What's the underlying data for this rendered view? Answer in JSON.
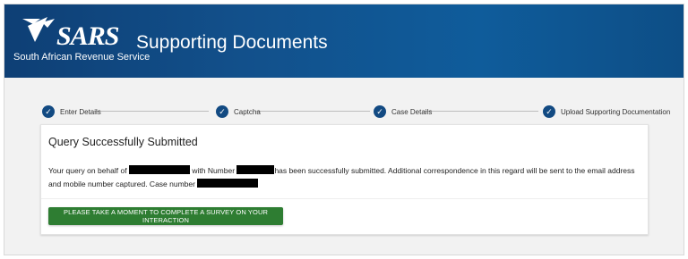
{
  "header": {
    "logo_text": "SARS",
    "org_name": "South African Revenue Service",
    "page_title": "Supporting Documents"
  },
  "stepper": {
    "steps": [
      {
        "label": "Enter Details",
        "status": "complete"
      },
      {
        "label": "Captcha",
        "status": "complete"
      },
      {
        "label": "Case Details",
        "status": "complete"
      },
      {
        "label": "Upload Supporting Documentation",
        "status": "complete"
      }
    ],
    "check_glyph": "✓"
  },
  "result": {
    "title": "Query Successfully Submitted",
    "text_1": "Your query on behalf of",
    "text_2": "with Number",
    "text_3": "has been successfully submitted. Additional correspondence in this regard will be sent to the email address and mobile number captured. Case number",
    "survey_button": "PLEASE TAKE A MOMENT TO COMPLETE A SURVEY ON YOUR INTERACTION"
  },
  "colors": {
    "header_blue": "#12508b",
    "step_blue": "#124a82",
    "button_green": "#2e7d32"
  }
}
